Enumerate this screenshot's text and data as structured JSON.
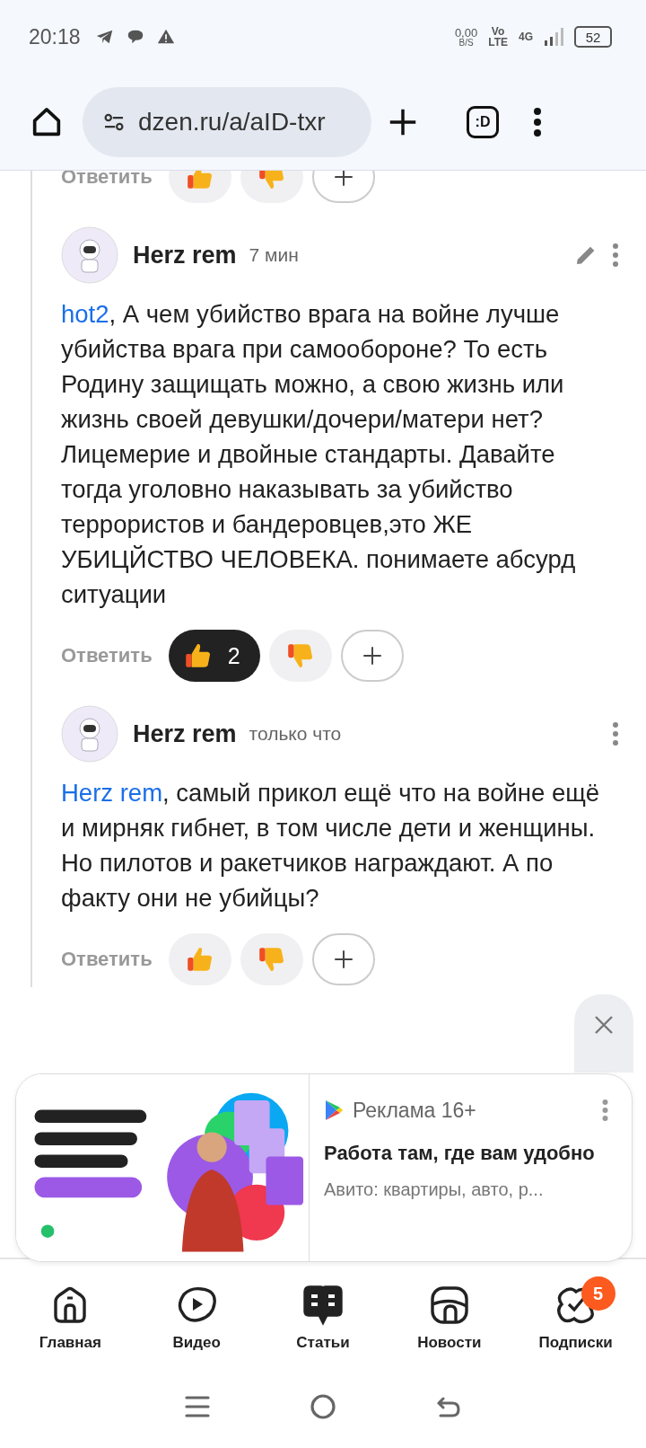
{
  "status_bar": {
    "time": "20:18",
    "net_speed": "0,00",
    "net_unit": "B/S",
    "volte_top": "Vo",
    "volte_bottom": "LTE",
    "network": "4G",
    "battery": "52"
  },
  "browser": {
    "url": "dzen.ru/a/aID-txr",
    "tab_label": ":D"
  },
  "top_reactions": {
    "reply": "Ответить"
  },
  "comments": [
    {
      "author": "Herz rem",
      "time": "7 мин",
      "editable": true,
      "mention": "hot2",
      "text": ", А чем убийство врага на войне лучше убийства врага при самообороне? То есть Родину защищать можно, а свою жизнь или жизнь своей девушки/дочери/матери нет? Лицемерие и двойные стандарты. Давайте тогда уголовно наказывать за убийство террористов и бандеровцев,это ЖЕ УБИЦЙСТВО ЧЕЛОВЕКА. понимаете абсурд ситуации",
      "reply": "Ответить",
      "like": {
        "selected": true,
        "count": "2"
      },
      "dislike": {
        "selected": false
      }
    },
    {
      "author": "Herz rem",
      "time": "только что",
      "editable": false,
      "mention": "Herz rem",
      "text": ", самый прикол ещё что на войне ещё и мирняк гибнет, в том числе дети и женщины. Но пилотов и ракетчиков награждают. А по факту они не убийцы?",
      "reply": "Ответить",
      "like": {
        "selected": false
      },
      "dislike": {
        "selected": false
      }
    }
  ],
  "ad": {
    "label": "Реклама 16+",
    "title": "Работа там, где вам удобно",
    "subtitle": "Авито: квартиры, авто, р..."
  },
  "bottom_nav": [
    {
      "label": "Главная",
      "selected": false
    },
    {
      "label": "Видео",
      "selected": false
    },
    {
      "label": "Статьи",
      "selected": true
    },
    {
      "label": "Новости",
      "selected": false
    },
    {
      "label": "Подписки",
      "selected": false,
      "badge": "5"
    }
  ]
}
